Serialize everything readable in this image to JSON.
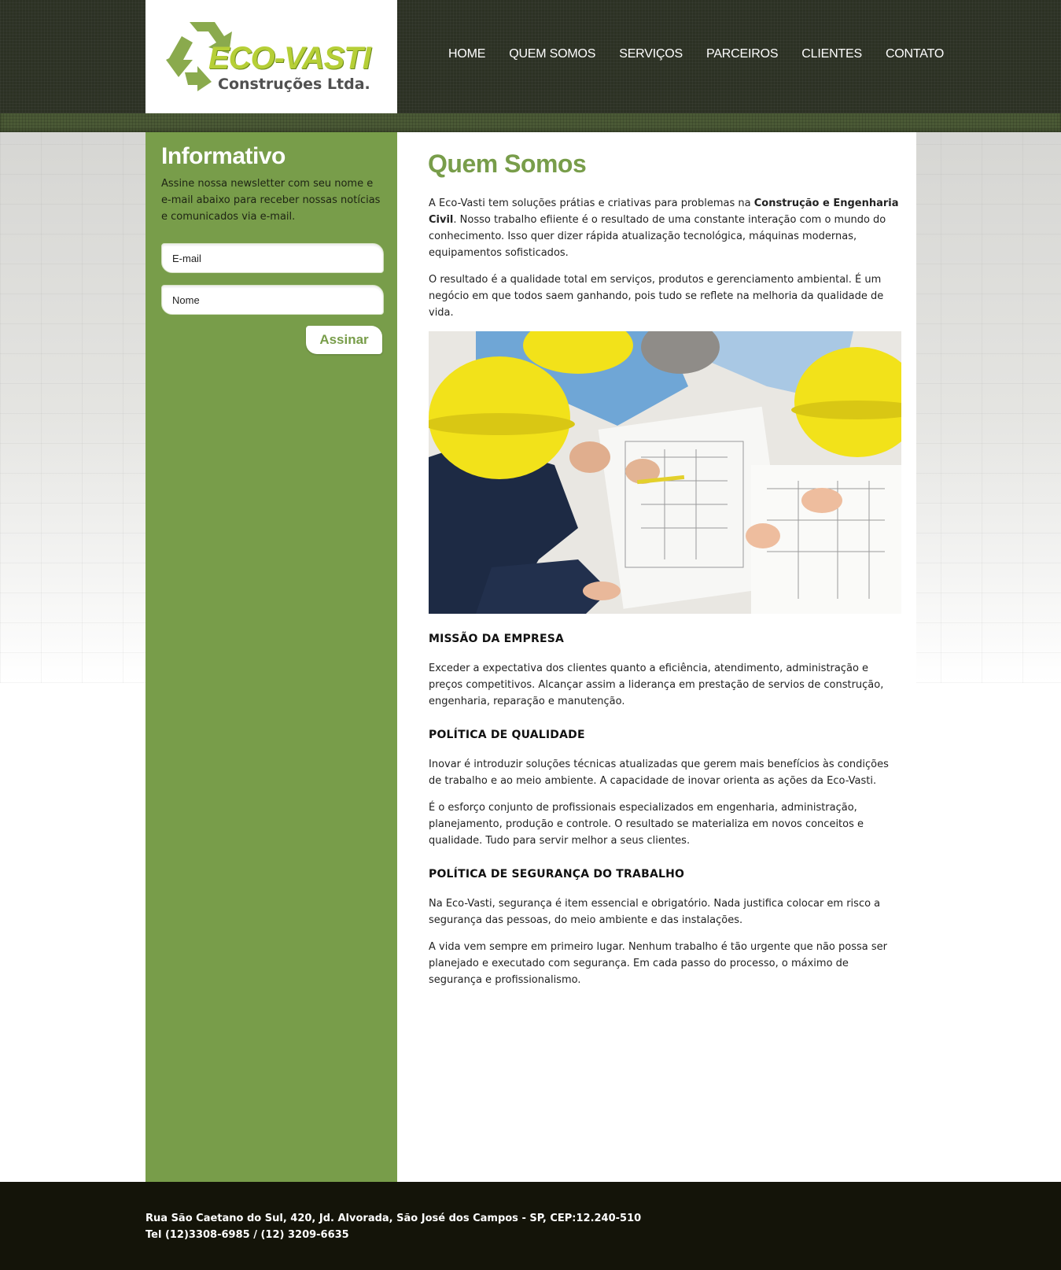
{
  "brand": {
    "logo_title": "ECO-VASTI",
    "logo_subtitle": "Construções Ltda."
  },
  "nav": {
    "items": [
      "HOME",
      "QUEM SOMOS",
      "SERVIÇOS",
      "PARCEIROS",
      "CLIENTES",
      "CONTATO"
    ]
  },
  "sidebar": {
    "title": "Informativo",
    "description": "Assine nossa newsletter com seu nome e e-mail abaixo para receber nossas notícias e comunicados via e-mail.",
    "email_placeholder": "E-mail",
    "name_placeholder": "Nome",
    "submit_label": "Assinar"
  },
  "content": {
    "title": "Quem Somos",
    "intro_p1_before": "A Eco-Vasti tem soluções prátias e criativas para problemas na ",
    "intro_p1_bold": "Construção e Engenharia Civil",
    "intro_p1_after": ". Nosso trabalho efiiente é o resultado de uma constante interação com o mundo do conhecimento. Isso quer dizer rápida atualização tecnológica, máquinas modernas, equipamentos sofisticados.",
    "intro_p2": "O resultado é a qualidade total em serviços, produtos e gerenciamento ambiental. É um negócio em que todos saem ganhando, pois tudo se reflete na melhoria da qualidade de vida.",
    "missao_heading": "MISSÃO DA EMPRESA",
    "missao_text": "Exceder a expectativa dos clientes quanto a eficiência, atendimento, administração e preços competitivos. Alcançar assim a liderança em prestação de servios de construção, engenharia, reparação e manutenção.",
    "qualidade_heading": "POLÍTICA DE QUALIDADE",
    "qualidade_p1": "Inovar é introduzir soluções técnicas atualizadas que gerem mais benefícios às condições de trabalho e ao meio ambiente. A capacidade de inovar orienta as ações da Eco-Vasti.",
    "qualidade_p2": "É o esforço conjunto de profissionais especializados em engenharia, administração, planejamento, produção e controle. O resultado se materializa em novos conceitos e qualidade. Tudo para servir melhor a seus clientes.",
    "seguranca_heading": "POLÍTICA DE SEGURANÇA DO TRABALHO",
    "seguranca_p1": "Na Eco-Vasti, segurança é item essencial e obrigatório. Nada justifica colocar em risco a segurança das pessoas, do meio ambiente e das instalações.",
    "seguranca_p2": "A vida vem sempre em primeiro lugar.  Nenhum trabalho é tão urgente que não possa ser planejado e executado com segurança. Em cada passo do processo, o máximo de segurança e profissionalismo."
  },
  "footer": {
    "address": "Rua São Caetano do Sul, 420, Jd. Alvorada, São José dos Campos - SP, CEP:12.240-510",
    "phone": "Tel (12)3308-6985 / (12) 3209-6635"
  },
  "colors": {
    "accent_green": "#789d4a",
    "logo_green": "#b6cf37",
    "header_dark": "#2c3124",
    "footer_dark": "#141409"
  },
  "icons": {
    "logo": "recycle-arrows-icon"
  }
}
